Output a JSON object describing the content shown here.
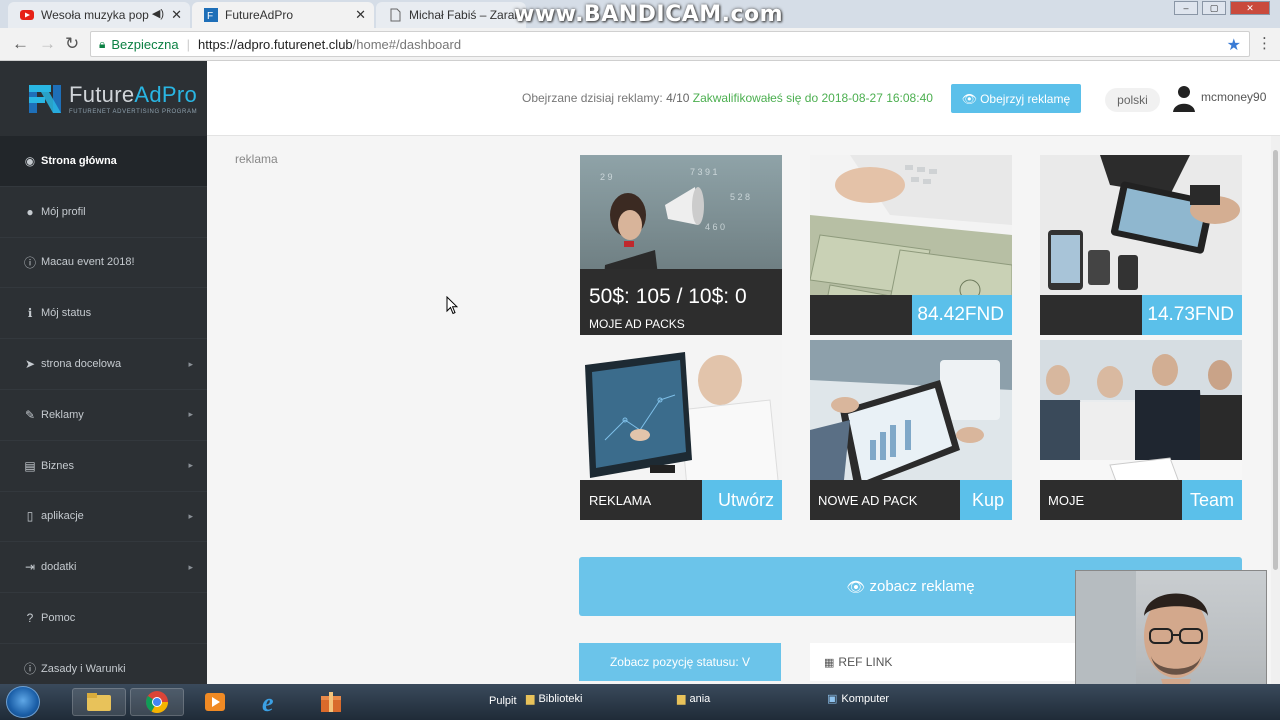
{
  "browser": {
    "tabs": [
      {
        "title": "Wesoła muzyka pop",
        "active": false
      },
      {
        "title": "FutureAdPro",
        "active": true
      },
      {
        "title": "Michał Fabiś – Zarabia",
        "active": false
      }
    ],
    "watermark": "www.BANDICAM.com",
    "secure_label": "Bezpieczna",
    "url_host": "https://adpro.futurenet.club",
    "url_path": "/home#/dashboard"
  },
  "logo": {
    "brand_a": "Future",
    "brand_b": "AdPro",
    "tagline": "FUTURENET ADVERTISING PROGRAM"
  },
  "sidebar": {
    "items": [
      {
        "label": "Strona główna",
        "icon": "dashboard-icon",
        "glyph": "◉",
        "active": true,
        "has_arrow": false
      },
      {
        "label": "Mój profil",
        "icon": "user-icon",
        "glyph": "●",
        "active": false,
        "has_arrow": false
      },
      {
        "label": "Macau event 2018!",
        "icon": "info-circle-icon",
        "glyph": "ⓘ",
        "active": false,
        "has_arrow": false
      },
      {
        "label": "Mój status",
        "icon": "info-icon",
        "glyph": "ℹ",
        "active": false,
        "has_arrow": false
      },
      {
        "label": "strona docelowa",
        "icon": "paper-plane-icon",
        "glyph": "➤",
        "active": false,
        "has_arrow": true
      },
      {
        "label": "Reklamy",
        "icon": "bullhorn-icon",
        "glyph": "✎",
        "active": false,
        "has_arrow": true
      },
      {
        "label": "Biznes",
        "icon": "briefcase-icon",
        "glyph": "▤",
        "active": false,
        "has_arrow": true
      },
      {
        "label": "aplikacje",
        "icon": "mobile-icon",
        "glyph": "▯",
        "active": false,
        "has_arrow": true
      },
      {
        "label": "dodatki",
        "icon": "sign-in-icon",
        "glyph": "⇥",
        "active": false,
        "has_arrow": true
      },
      {
        "label": "Pomoc",
        "icon": "question-icon",
        "glyph": "?",
        "active": false,
        "has_arrow": false
      },
      {
        "label": "Zasady i Warunki",
        "icon": "info-circle-icon",
        "glyph": "ⓘ",
        "active": false,
        "has_arrow": false
      }
    ]
  },
  "header": {
    "watched_label": "Obejrzane dzisiaj reklamy:",
    "watched_count": "4/10",
    "qualified": "Zakwalifikowałeś się do 2018-08-27 16:08:40",
    "watch_button": "Obejrzyj reklamę",
    "language": "polski",
    "username": "mcmoney90"
  },
  "content": {
    "label": "reklama",
    "tiles": [
      {
        "big": "50$: 105 / 10$: 0",
        "small": "MOJE AD PACKS"
      },
      {
        "value": "84.42FND"
      },
      {
        "value": "14.73FND"
      },
      {
        "label": "REKLAMA",
        "action": "Utwórz"
      },
      {
        "label": "NOWE AD PACK",
        "action": "Kup"
      },
      {
        "label": "MOJE",
        "action": "Team"
      }
    ],
    "watch_ad_button": "zobacz reklamę",
    "status_button": "Zobacz pozycję statusu: V",
    "ref_link": "REF LINK"
  },
  "taskbar": {
    "pulpit": "Pulpit",
    "biblioteki": "Biblioteki",
    "ania": "ania",
    "komputer": "Komputer"
  },
  "colors": {
    "accent": "#5bc0ea",
    "sidebar": "#2c3034",
    "success": "#4caf50",
    "tile_bar": "#2d2d2d"
  }
}
